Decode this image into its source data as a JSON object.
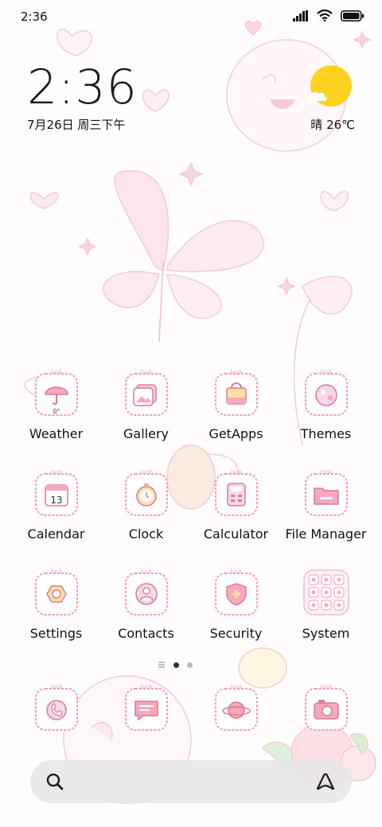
{
  "status_bar": {
    "time": "2:36"
  },
  "clock_widget": {
    "time": "2:36",
    "date": "7月26日 周三下午"
  },
  "weather_widget": {
    "condition": "晴",
    "temperature": "26℃",
    "text": "晴 26℃"
  },
  "apps": [
    {
      "label": "Weather",
      "icon": "umbrella-icon",
      "badge": "0°"
    },
    {
      "label": "Gallery",
      "icon": "photos-icon"
    },
    {
      "label": "GetApps",
      "icon": "shopping-bag-icon"
    },
    {
      "label": "Themes",
      "icon": "palette-icon"
    },
    {
      "label": "Calendar",
      "icon": "calendar-icon",
      "badge": "13"
    },
    {
      "label": "Clock",
      "icon": "stopwatch-icon"
    },
    {
      "label": "Calculator",
      "icon": "calculator-icon"
    },
    {
      "label": "File Manager",
      "icon": "folder-icon"
    },
    {
      "label": "Settings",
      "icon": "gear-icon"
    },
    {
      "label": "Contacts",
      "icon": "person-icon"
    },
    {
      "label": "Security",
      "icon": "shield-plus-icon"
    },
    {
      "label": "System",
      "icon": "folder-grid-icon"
    }
  ],
  "icon_frame_text": "luck",
  "dock": [
    {
      "icon": "phone-icon"
    },
    {
      "icon": "message-icon"
    },
    {
      "icon": "browser-planet-icon"
    },
    {
      "icon": "camera-icon"
    }
  ],
  "page_indicator": {
    "pages": 2,
    "current": 1
  },
  "search_bar": {
    "placeholder": ""
  },
  "colors": {
    "accent_pink": "#f19bb3",
    "icon_bg": "#fde8ef",
    "sun": "#ffd21f"
  }
}
